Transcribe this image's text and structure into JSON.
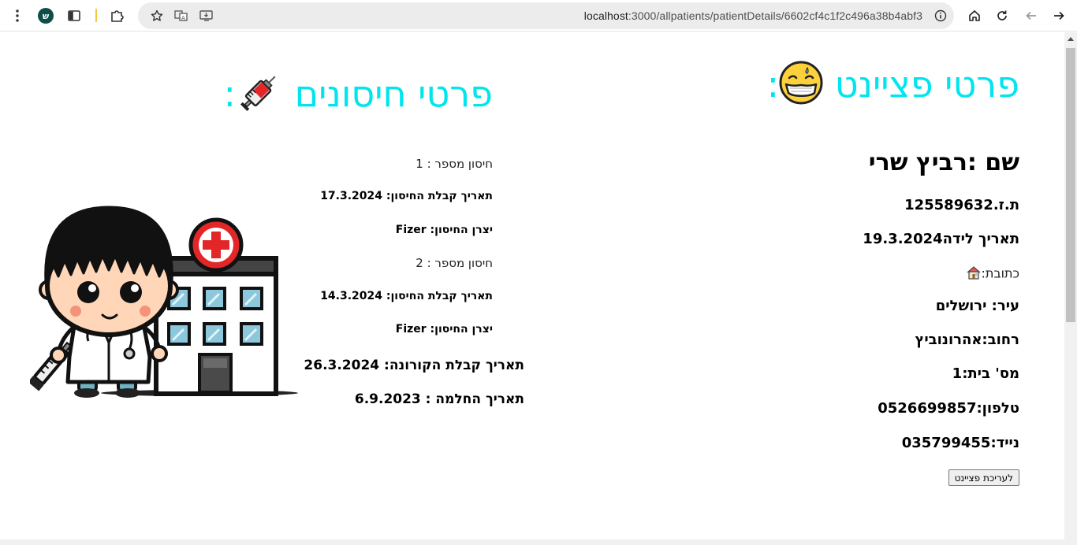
{
  "browser": {
    "url_host": "localhost",
    "url_path": ":3000/allpatients/patientDetails/6602cf4c1f2c496a38b4abf3",
    "profile_initial": "ש"
  },
  "patient": {
    "title": "פרטי פציינט",
    "title_colon": ":",
    "name": "שם :רביץ שרי",
    "id": "ת.ז.125589632",
    "birth_date": "תאריך לידה19.3.2024",
    "address_label": "כתובת:",
    "city": "עיר: ירושלים",
    "street": "רחוב:אהרונוביץ",
    "house_number": "מס' בית:1",
    "phone": "טלפון:0526699857",
    "mobile": "נייד:035799455",
    "edit_button": "לעריכת פציינט"
  },
  "vaccines": {
    "title": "פרטי חיסונים",
    "title_colon": ":",
    "items": [
      {
        "number": "חיסון מספר : 1",
        "date": "תאריך קבלת החיסון: 17.3.2024",
        "maker": "יצרן החיסון: Fizer"
      },
      {
        "number": "חיסון מספר : 2",
        "date": "תאריך קבלת החיסון: 14.3.2024",
        "maker": "יצרן החיסון: Fizer"
      }
    ],
    "covid_positive_date": "תאריך קבלת הקורונה: 26.3.2024",
    "recovery_date": "תאריך החלמה : 6.9.2023"
  },
  "colors": {
    "title_cyan": "#00e5ee",
    "profile_bg": "#0e4e4a"
  },
  "icons": {
    "title_patient_emoji": "face-with-medical-mask-icon",
    "title_vaccine_emoji": "syringe-icon",
    "address_emoji": "house-icon",
    "illustration": "doctor-and-hospital-illustration"
  }
}
